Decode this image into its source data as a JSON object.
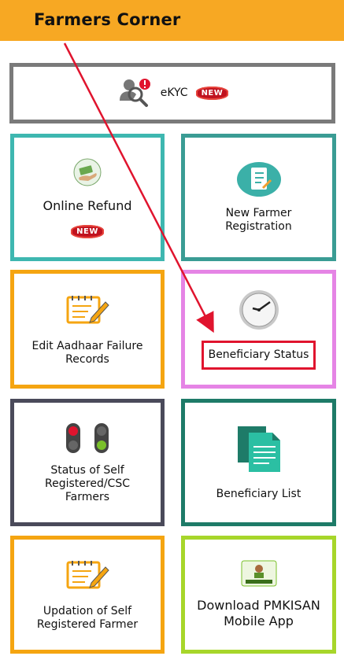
{
  "header": {
    "title": "Farmers Corner"
  },
  "tiles": {
    "ekyc": {
      "label": "eKYC",
      "badge": "NEW"
    },
    "online_refund": {
      "label": "Online Refund",
      "badge": "NEW"
    },
    "new_farmer": {
      "label_line1": "New Farmer",
      "label_line2": "Registration"
    },
    "edit_aadhaar": {
      "label_line1": "Edit Aadhaar Failure",
      "label_line2": "Records"
    },
    "beneficiary_status": {
      "label": "Beneficiary Status"
    },
    "self_registered": {
      "label_line1": "Status of Self",
      "label_line2": "Registered/CSC",
      "label_line3": "Farmers"
    },
    "beneficiary_list": {
      "label": "Beneficiary List"
    },
    "updation": {
      "label_line1": "Updation of Self",
      "label_line2": "Registered Farmer"
    },
    "download_app": {
      "label_line1": "Download PMKISAN",
      "label_line2": "Mobile App",
      "logo_text": "PMKISAN"
    }
  },
  "colors": {
    "header_bg": "#f7a823",
    "arrow": "#e0142e",
    "badge_red": "#c0121f"
  },
  "icons": [
    "search-person-icon",
    "alert-icon",
    "money-hand-icon",
    "form-icon",
    "edit-notepad-icon",
    "clock-icon",
    "traffic-light-icon",
    "documents-icon",
    "pmkisan-logo-icon"
  ]
}
